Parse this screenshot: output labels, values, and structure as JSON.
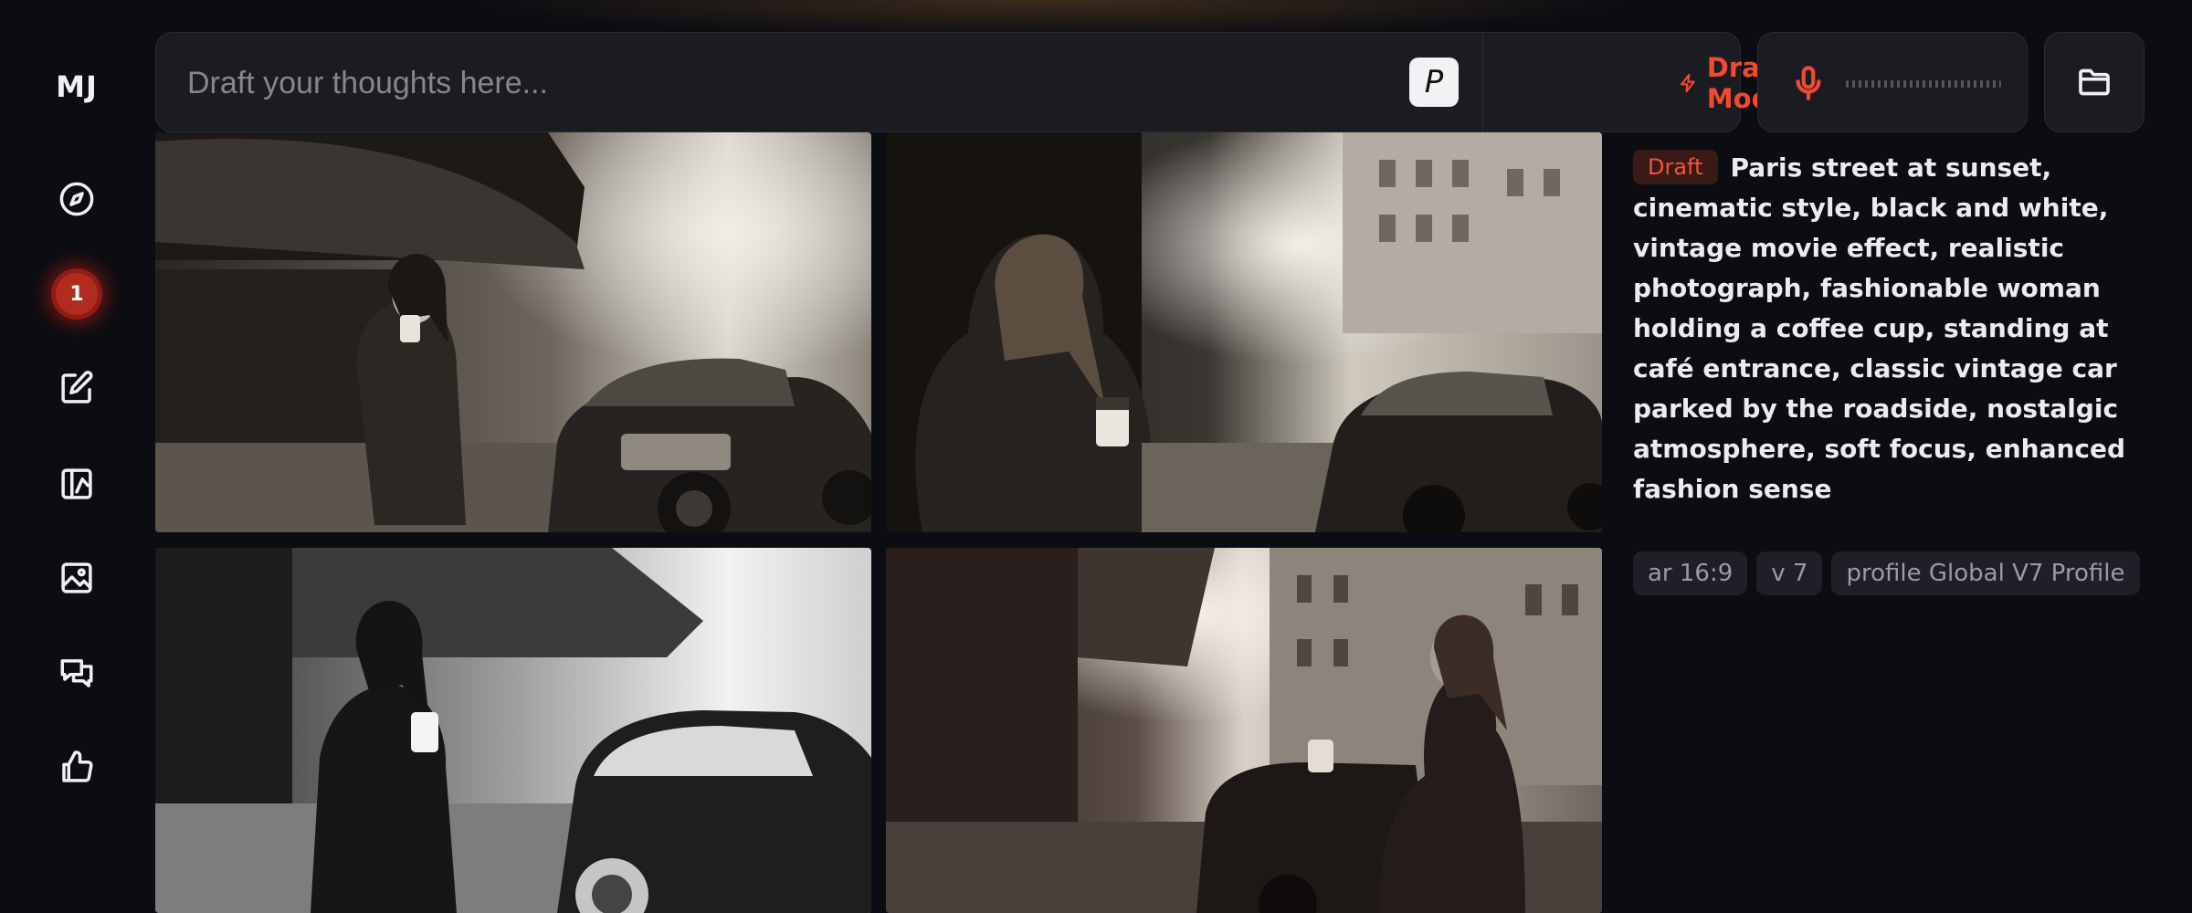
{
  "sidebar": {
    "logo": "MJ",
    "badge_count": "1",
    "items": [
      {
        "icon": "compass-icon",
        "label": "explore"
      },
      {
        "icon": "notification-badge",
        "label": "queue"
      },
      {
        "icon": "edit-icon",
        "label": "edit"
      },
      {
        "icon": "personalize-icon",
        "label": "personalize"
      },
      {
        "icon": "image-icon",
        "label": "organize"
      },
      {
        "icon": "chat-icon",
        "label": "chat"
      },
      {
        "icon": "thumbs-up-icon",
        "label": "rank"
      }
    ]
  },
  "prompt_bar": {
    "placeholder": "Draft your thoughts here...",
    "value": "",
    "personalize_label": "P",
    "draft_mode_label": "Draft Mode",
    "accent_color": "#f04a30"
  },
  "voice": {
    "icon": "microphone-icon"
  },
  "folder": {
    "icon": "folder-icon"
  },
  "images": [
    {
      "name": "result-image-1"
    },
    {
      "name": "result-image-2"
    },
    {
      "name": "result-image-3"
    },
    {
      "name": "result-image-4"
    }
  ],
  "details": {
    "tag": "Draft",
    "prompt": "Paris street at sunset, cinematic style, black and white, vintage movie effect, realistic photograph, fashionable woman holding a coffee cup, standing at café entrance, classic vintage car parked by the roadside, nostalgic atmosphere, soft focus, enhanced fashion sense",
    "params": [
      {
        "label": "ar 16:9"
      },
      {
        "label": "v 7"
      },
      {
        "label": "profile Global V7 Profile"
      }
    ]
  }
}
